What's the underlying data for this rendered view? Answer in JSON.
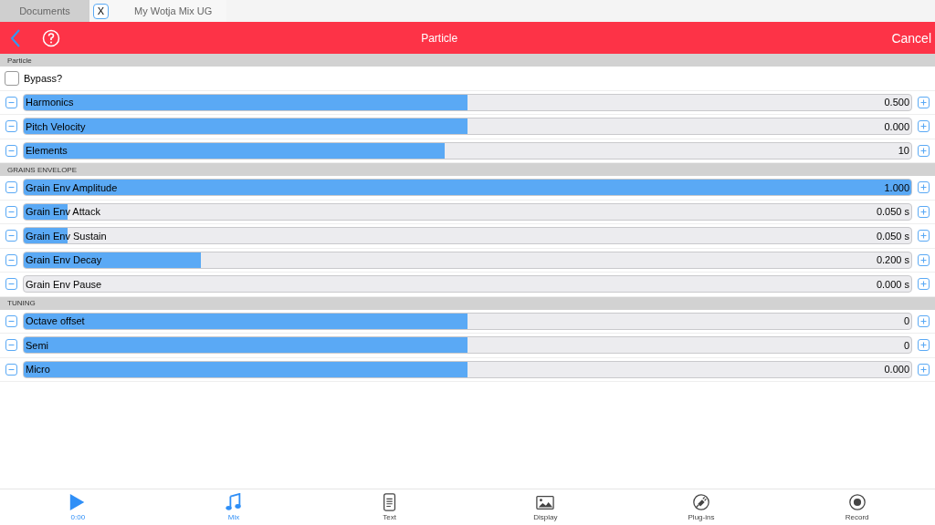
{
  "doc_tabs": [
    {
      "label": "Documents",
      "selected": false,
      "closable": false
    },
    {
      "label": "My Wotja Mix UG",
      "selected": true,
      "closable": true,
      "close_label": "X"
    }
  ],
  "header": {
    "title": "Particle",
    "action": "Cancel"
  },
  "sections": [
    {
      "title": "Particle",
      "rows": [
        {
          "kind": "checkbox",
          "label": "Bypass?",
          "checked": false
        },
        {
          "kind": "slider",
          "label": "Harmonics",
          "value": "0.500",
          "level": 0.5
        },
        {
          "kind": "slider",
          "label": "Pitch Velocity",
          "value": "0.000",
          "level": 0.5
        },
        {
          "kind": "slider",
          "label": "Elements",
          "value": "10",
          "level": 0.474
        }
      ]
    },
    {
      "title": "GRAINS ENVELOPE",
      "rows": [
        {
          "kind": "slider",
          "label": "Grain Env Amplitude",
          "value": "1.000",
          "level": 1
        },
        {
          "kind": "slider",
          "label": "Grain Env Attack",
          "value": "0.050 s",
          "level": 0.049
        },
        {
          "kind": "slider",
          "label": "Grain Env Sustain",
          "value": "0.050 s",
          "level": 0.049
        },
        {
          "kind": "slider",
          "label": "Grain Env Decay",
          "value": "0.200 s",
          "level": 0.2
        },
        {
          "kind": "slider",
          "label": "Grain Env Pause",
          "value": "0.000 s",
          "level": 0
        }
      ]
    },
    {
      "title": "TUNING",
      "rows": [
        {
          "kind": "slider",
          "label": "Octave offset",
          "value": "0",
          "level": 0.5
        },
        {
          "kind": "slider",
          "label": "Semi",
          "value": "0",
          "level": 0.5
        },
        {
          "kind": "slider",
          "label": "Micro",
          "value": "0.000",
          "level": 0.5
        }
      ]
    }
  ],
  "tab_bar": [
    {
      "label": "0:00",
      "selected": true
    },
    {
      "label": "Mix",
      "selected": true
    },
    {
      "label": "Text",
      "selected": false
    },
    {
      "label": "Display",
      "selected": false
    },
    {
      "label": "Plug-ins",
      "selected": false
    },
    {
      "label": "Record",
      "selected": false
    }
  ]
}
